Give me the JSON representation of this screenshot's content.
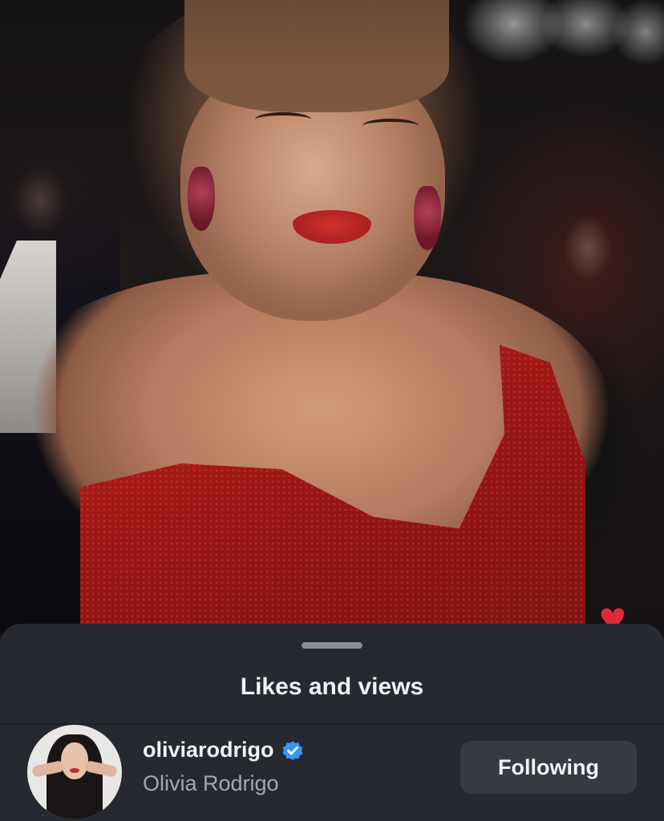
{
  "sheet": {
    "title": "Likes and views"
  },
  "user_row": {
    "username": "oliviarodrigo",
    "full_name": "Olivia Rodrigo",
    "verified": true,
    "follow_button_label": "Following"
  },
  "icons": {
    "verified": "verified-badge-icon",
    "heart": "heart-icon"
  },
  "colors": {
    "sheet_background": "#262a30",
    "verified_blue": "#3897f0",
    "heart_red": "#e0293a",
    "button_background": "#363a41"
  }
}
